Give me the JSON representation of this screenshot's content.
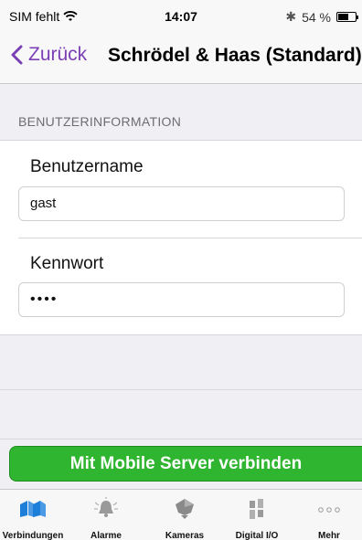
{
  "status_bar": {
    "carrier": "SIM fehlt",
    "time": "14:07",
    "battery_text": "54 %",
    "battery_level": 0.54
  },
  "nav": {
    "back_label": "Zurück",
    "title": "Schrödel & Haas (Standard)"
  },
  "section": {
    "header": "BENUTZERINFORMATION"
  },
  "form": {
    "username_label": "Benutzername",
    "username_value": "gast",
    "password_label": "Kennwort",
    "password_value": "••••"
  },
  "connect_button": "Mit Mobile Server verbinden",
  "tabs": [
    {
      "label": "Verbindungen",
      "icon": "connections-icon",
      "active": true
    },
    {
      "label": "Alarme",
      "icon": "bell-icon",
      "active": false
    },
    {
      "label": "Kameras",
      "icon": "camera-icon",
      "active": false
    },
    {
      "label": "Digital I/O",
      "icon": "digital-io-icon",
      "active": false
    },
    {
      "label": "Mehr",
      "icon": "more-icon",
      "active": false
    }
  ],
  "colors": {
    "accent": "#7b3fb5",
    "active_tab": "#1e7fd8",
    "button_green": "#2fb52f"
  }
}
